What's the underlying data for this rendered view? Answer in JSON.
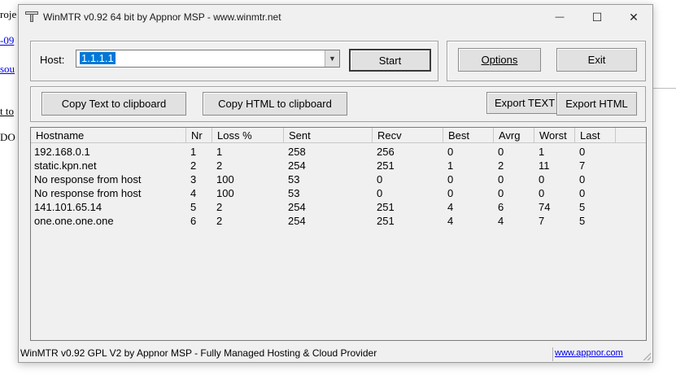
{
  "background": {
    "lines": [
      "roje",
      "-09",
      "sou",
      "t to",
      "DO"
    ]
  },
  "window": {
    "title": "WinMTR v0.92 64 bit by Appnor MSP - www.winmtr.net",
    "controls": {
      "minimize": "—",
      "maximize": "☐",
      "close": "✕"
    }
  },
  "host": {
    "label": "Host:",
    "value": "1.1.1.1",
    "start_label": "Start"
  },
  "actions": {
    "options_label": "Options",
    "exit_label": "Exit",
    "copy_text_label": "Copy Text to clipboard",
    "copy_html_label": "Copy HTML to clipboard",
    "export_text_label": "Export TEXT",
    "export_html_label": "Export HTML"
  },
  "table": {
    "columns": [
      "Hostname",
      "Nr",
      "Loss %",
      "Sent",
      "Recv",
      "Best",
      "Avrg",
      "Worst",
      "Last"
    ],
    "rows": [
      [
        "192.168.0.1",
        "1",
        "1",
        "258",
        "256",
        "0",
        "0",
        "1",
        "0"
      ],
      [
        "static.kpn.net",
        "2",
        "2",
        "254",
        "251",
        "1",
        "2",
        "11",
        "7"
      ],
      [
        "No response from host",
        "3",
        "100",
        "53",
        "0",
        "0",
        "0",
        "0",
        "0"
      ],
      [
        "No response from host",
        "4",
        "100",
        "53",
        "0",
        "0",
        "0",
        "0",
        "0"
      ],
      [
        "141.101.65.14",
        "5",
        "2",
        "254",
        "251",
        "4",
        "6",
        "74",
        "5"
      ],
      [
        "one.one.one.one",
        "6",
        "2",
        "254",
        "251",
        "4",
        "4",
        "7",
        "5"
      ]
    ]
  },
  "status": {
    "text": "WinMTR v0.92 GPL V2 by Appnor MSP - Fully Managed Hosting & Cloud Provider",
    "link": "www.appnor.com"
  }
}
